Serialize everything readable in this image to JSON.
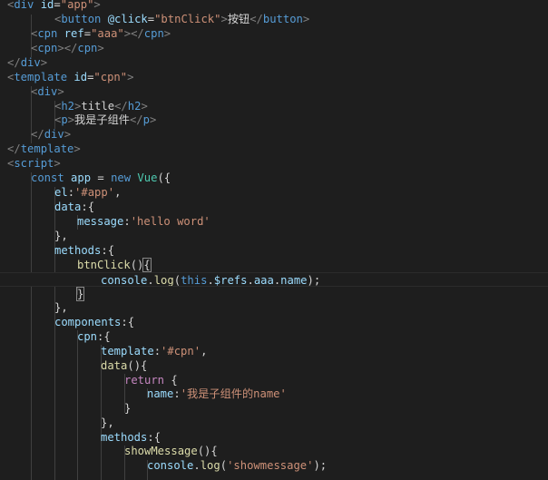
{
  "editor": {
    "colors": {
      "background": "#1e1e1e",
      "tag": "#569cd6",
      "attribute": "#9cdcfe",
      "string": "#ce9178",
      "keyword": "#569cd6",
      "function": "#dcdcaa",
      "class": "#4ec9b0",
      "control": "#c586c0"
    },
    "lines": [
      [
        [
          "punct",
          "<"
        ],
        [
          "tag",
          "div"
        ],
        [
          "plain",
          " "
        ],
        [
          "attr",
          "id"
        ],
        [
          "plain",
          "="
        ],
        [
          "str",
          "\"app\""
        ],
        [
          "punct",
          ">"
        ]
      ],
      [
        [
          "punct",
          "<"
        ],
        [
          "tag",
          "button"
        ],
        [
          "plain",
          " "
        ],
        [
          "attr",
          "@click"
        ],
        [
          "plain",
          "="
        ],
        [
          "str",
          "\"btnClick\""
        ],
        [
          "punct",
          ">"
        ],
        [
          "txt",
          "按钮"
        ],
        [
          "punct",
          "</"
        ],
        [
          "tag",
          "button"
        ],
        [
          "punct",
          ">"
        ]
      ],
      [
        [
          "punct",
          "<"
        ],
        [
          "tag",
          "cpn"
        ],
        [
          "plain",
          " "
        ],
        [
          "attr",
          "ref"
        ],
        [
          "plain",
          "="
        ],
        [
          "str",
          "\"aaa\""
        ],
        [
          "punct",
          "></"
        ],
        [
          "tag",
          "cpn"
        ],
        [
          "punct",
          ">"
        ]
      ],
      [
        [
          "punct",
          "<"
        ],
        [
          "tag",
          "cpn"
        ],
        [
          "punct",
          "></"
        ],
        [
          "tag",
          "cpn"
        ],
        [
          "punct",
          ">"
        ]
      ],
      [
        [
          "punct",
          "</"
        ],
        [
          "tag",
          "div"
        ],
        [
          "punct",
          ">"
        ]
      ],
      [
        [
          "punct",
          "<"
        ],
        [
          "tag",
          "template"
        ],
        [
          "plain",
          " "
        ],
        [
          "attr",
          "id"
        ],
        [
          "plain",
          "="
        ],
        [
          "str",
          "\"cpn\""
        ],
        [
          "punct",
          ">"
        ]
      ],
      [
        [
          "punct",
          "<"
        ],
        [
          "tag",
          "div"
        ],
        [
          "punct",
          ">"
        ]
      ],
      [
        [
          "punct",
          "<"
        ],
        [
          "tag",
          "h2"
        ],
        [
          "punct",
          ">"
        ],
        [
          "plain",
          "title"
        ],
        [
          "punct",
          "</"
        ],
        [
          "tag",
          "h2"
        ],
        [
          "punct",
          ">"
        ]
      ],
      [
        [
          "punct",
          "<"
        ],
        [
          "tag",
          "p"
        ],
        [
          "punct",
          ">"
        ],
        [
          "txt",
          "我是子组件"
        ],
        [
          "punct",
          "</"
        ],
        [
          "tag",
          "p"
        ],
        [
          "punct",
          ">"
        ]
      ],
      [
        [
          "punct",
          "</"
        ],
        [
          "tag",
          "div"
        ],
        [
          "punct",
          ">"
        ]
      ],
      [
        [
          "punct",
          "</"
        ],
        [
          "tag",
          "template"
        ],
        [
          "punct",
          ">"
        ]
      ],
      [
        [
          "punct",
          "<"
        ],
        [
          "tag",
          "script"
        ],
        [
          "punct",
          ">"
        ]
      ],
      [
        [
          "kw",
          "const"
        ],
        [
          "plain",
          " "
        ],
        [
          "var",
          "app"
        ],
        [
          "plain",
          " = "
        ],
        [
          "kw",
          "new"
        ],
        [
          "plain",
          " "
        ],
        [
          "cls",
          "Vue"
        ],
        [
          "plain",
          "({"
        ]
      ],
      [
        [
          "var",
          "el"
        ],
        [
          "plain",
          ":"
        ],
        [
          "str",
          "'#app'"
        ],
        [
          "plain",
          ","
        ]
      ],
      [
        [
          "var",
          "data"
        ],
        [
          "plain",
          ":{"
        ]
      ],
      [
        [
          "var",
          "message"
        ],
        [
          "plain",
          ":"
        ],
        [
          "str",
          "'hello word'"
        ]
      ],
      [
        [
          "plain",
          "},"
        ]
      ],
      [
        [
          "var",
          "methods"
        ],
        [
          "plain",
          ":{"
        ]
      ],
      [
        [
          "fn",
          "btnClick"
        ],
        [
          "plain",
          "()"
        ],
        [
          "box",
          "{"
        ]
      ],
      [
        [
          "var",
          "console"
        ],
        [
          "plain",
          "."
        ],
        [
          "fn",
          "log"
        ],
        [
          "plain",
          "("
        ],
        [
          "kw",
          "this"
        ],
        [
          "plain",
          "."
        ],
        [
          "var",
          "$refs"
        ],
        [
          "plain",
          "."
        ],
        [
          "var",
          "aaa"
        ],
        [
          "plain",
          "."
        ],
        [
          "var",
          "name"
        ],
        [
          "plain",
          ");"
        ]
      ],
      [
        [
          "box",
          "}"
        ]
      ],
      [
        [
          "plain",
          "},"
        ]
      ],
      [
        [
          "var",
          "components"
        ],
        [
          "plain",
          ":{"
        ]
      ],
      [
        [
          "var",
          "cpn"
        ],
        [
          "plain",
          ":{"
        ]
      ],
      [
        [
          "var",
          "template"
        ],
        [
          "plain",
          ":"
        ],
        [
          "str",
          "'#cpn'"
        ],
        [
          "plain",
          ","
        ]
      ],
      [
        [
          "fn",
          "data"
        ],
        [
          "plain",
          "(){"
        ]
      ],
      [
        [
          "ctrl",
          "return"
        ],
        [
          "plain",
          " {"
        ]
      ],
      [
        [
          "var",
          "name"
        ],
        [
          "plain",
          ":"
        ],
        [
          "str",
          "'我是子组件的name'"
        ]
      ],
      [
        [
          "plain",
          "}"
        ]
      ],
      [
        [
          "plain",
          "},"
        ]
      ],
      [
        [
          "var",
          "methods"
        ],
        [
          "plain",
          ":{"
        ]
      ],
      [
        [
          "fn",
          "showMessage"
        ],
        [
          "plain",
          "(){"
        ]
      ],
      [
        [
          "var",
          "console"
        ],
        [
          "plain",
          "."
        ],
        [
          "fn",
          "log"
        ],
        [
          "plain",
          "("
        ],
        [
          "str",
          "'showmessage'"
        ],
        [
          "plain",
          ");"
        ]
      ]
    ]
  }
}
